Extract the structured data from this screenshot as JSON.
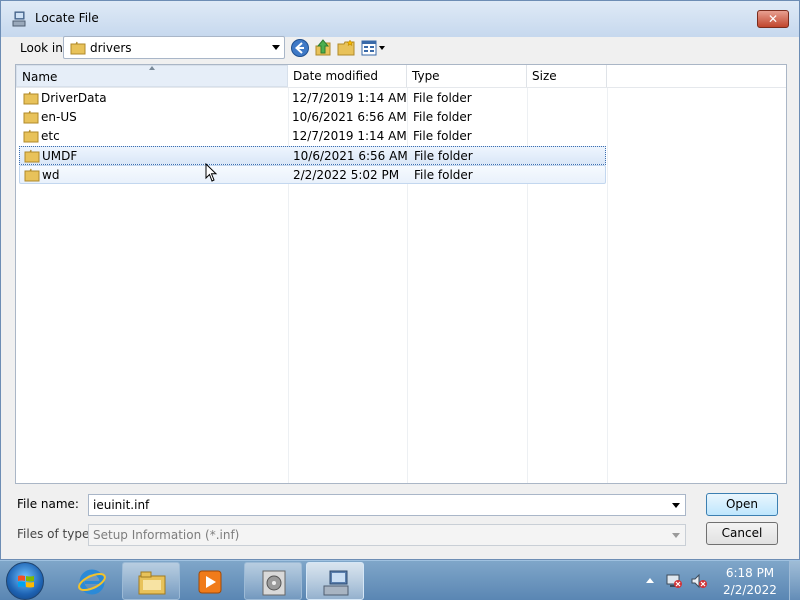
{
  "window": {
    "title": "Locate File",
    "close_label": "✕"
  },
  "toolbar": {
    "look_in_label": "Look in:",
    "look_in_value": "drivers"
  },
  "list": {
    "columns": [
      "Name",
      "Date modified",
      "Type",
      "Size"
    ],
    "rows": [
      {
        "name": "DriverData",
        "date": "12/7/2019 1:14 AM",
        "type": "File folder"
      },
      {
        "name": "en-US",
        "date": "10/6/2021 6:56 AM",
        "type": "File folder"
      },
      {
        "name": "etc",
        "date": "12/7/2019 1:14 AM",
        "type": "File folder"
      },
      {
        "name": "UMDF",
        "date": "10/6/2021 6:56 AM",
        "type": "File folder"
      },
      {
        "name": "wd",
        "date": "2/2/2022 5:02 PM",
        "type": "File folder"
      }
    ],
    "selected_row": "UMDF",
    "hovered_row": "wd"
  },
  "footer": {
    "file_name_label": "File name:",
    "file_name_value": "ieuinit.inf",
    "file_type_label": "Files of type:",
    "file_type_value": "Setup Information (*.inf)",
    "open_label": "Open",
    "cancel_label": "Cancel"
  },
  "taskbar": {
    "time": "6:18 PM",
    "date": "2/2/2022",
    "items": [
      "start-button",
      "internet-explorer-icon",
      "windows-explorer-icon",
      "media-player-icon",
      "disk-utility-icon",
      "setup-app-icon"
    ]
  },
  "colors": {
    "selection_border": "#84acdd",
    "taskbar": "#5a86b3",
    "dialog_bg": "#f0f0f0"
  }
}
